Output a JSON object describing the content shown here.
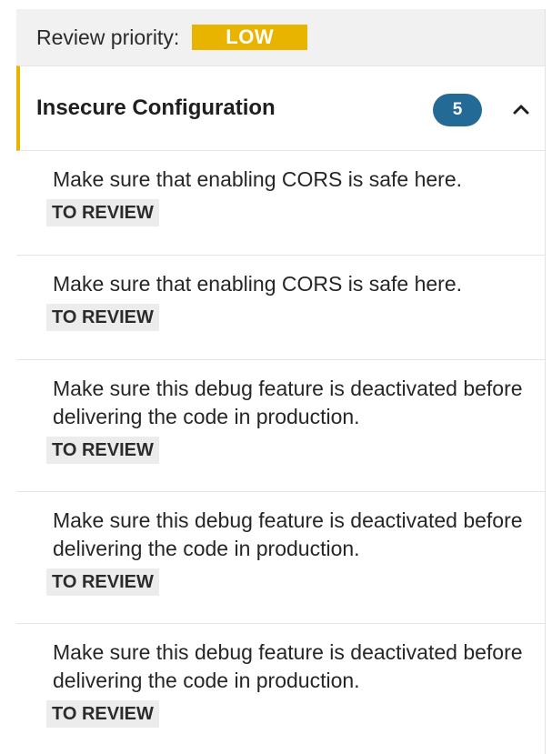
{
  "review_priority": {
    "label": "Review priority:",
    "value": "LOW",
    "color": "#e8b400"
  },
  "category": {
    "title": "Insecure Configuration",
    "count": "5",
    "expanded": true,
    "count_color": "#236a97"
  },
  "issues": [
    {
      "message": "Make sure that enabling CORS is safe here.",
      "status": "TO REVIEW"
    },
    {
      "message": "Make sure that enabling CORS is safe here.",
      "status": "TO REVIEW"
    },
    {
      "message": "Make sure this debug feature is deactivated before delivering the code in production.",
      "status": "TO REVIEW"
    },
    {
      "message": "Make sure this debug feature is deactivated before delivering the code in production.",
      "status": "TO REVIEW"
    },
    {
      "message": "Make sure this debug feature is deactivated before delivering the code in production.",
      "status": "TO REVIEW"
    }
  ]
}
